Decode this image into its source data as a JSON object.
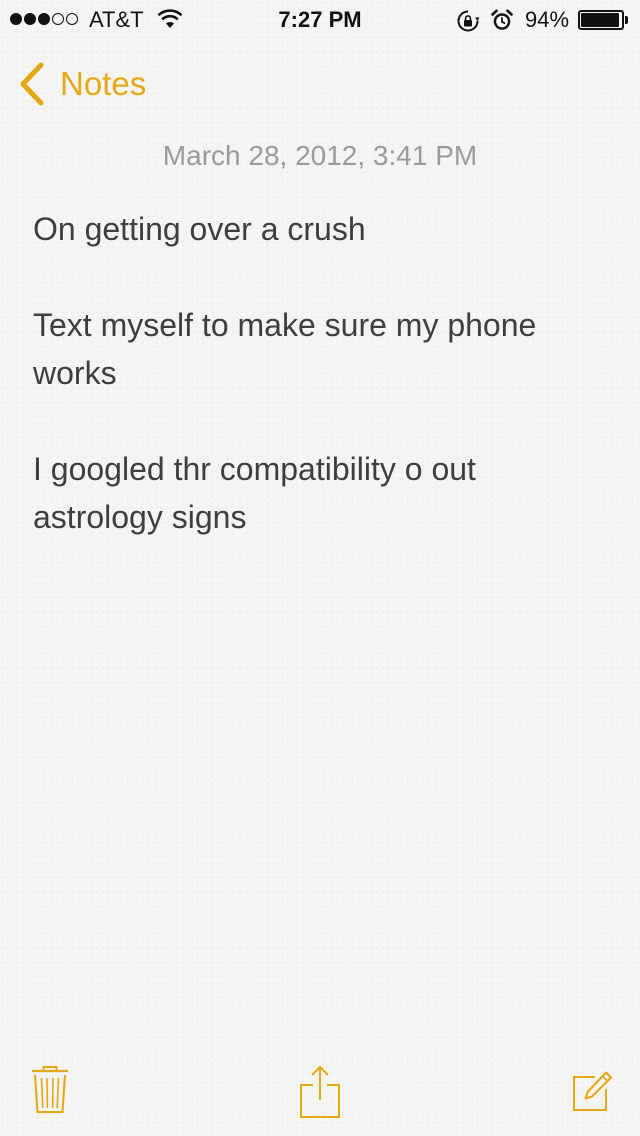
{
  "status_bar": {
    "signal_total": 5,
    "signal_filled": 3,
    "carrier": "AT&T",
    "time": "7:27 PM",
    "battery_percent_text": "94%",
    "battery_level": 0.94,
    "icons": [
      "wifi-icon",
      "rotation-lock-icon",
      "alarm-icon",
      "battery-icon"
    ]
  },
  "nav": {
    "back_label": "Notes",
    "back_icon": "chevron-left-icon"
  },
  "note": {
    "date": "March 28, 2012, 3:41 PM",
    "paragraphs": [
      "On getting over a crush",
      "Text myself to make sure my phone works",
      "I googled thr compatibility o out astrology signs"
    ]
  },
  "toolbar": {
    "icons": [
      "trash-icon",
      "share-icon",
      "compose-icon"
    ]
  },
  "colors": {
    "accent": "#e4a716",
    "date_text": "#9a9a9a",
    "body_text": "#3e3e3e",
    "background": "#f4f4f2"
  }
}
